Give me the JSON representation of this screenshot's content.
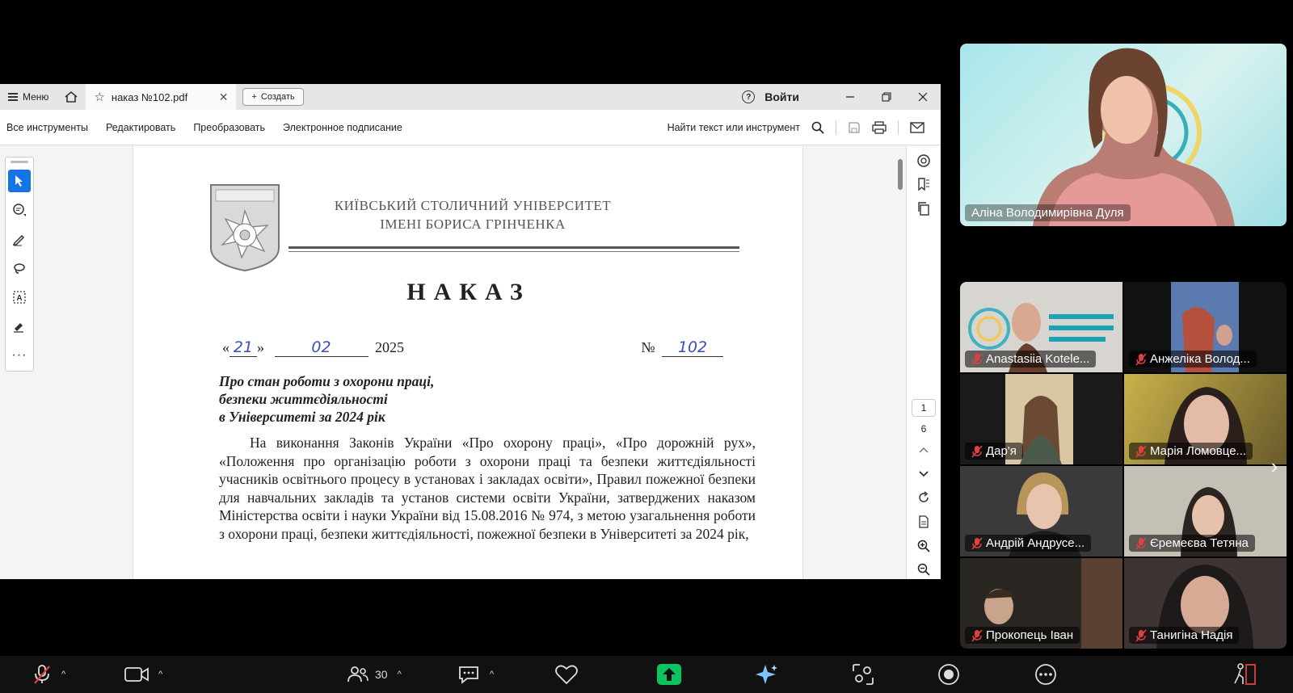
{
  "acrobat": {
    "menu_label": "Меню",
    "tab_title": "наказ №102.pdf",
    "create_label": "Создать",
    "signin_label": "Войти",
    "toolbar": {
      "all_tools": "Все инструменты",
      "edit": "Редактировать",
      "convert": "Преобразовать",
      "esign": "Электронное подписание",
      "search_label": "Найти текст или инструмент"
    },
    "page_current": "1",
    "page_total": "6"
  },
  "document": {
    "university_line1": "КИЇВСЬКИЙ СТОЛИЧНИЙ УНІВЕРСИТЕТ",
    "university_line2": "ІМЕНІ БОРИСА ГРІНЧЕНКА",
    "heading": "НАКАЗ",
    "date_open_quote": "«",
    "date_day": "21",
    "date_close_quote": "»",
    "date_month": "02",
    "date_year": "2025",
    "number_label": "№",
    "number_value": "102",
    "subject_line1": "Про стан роботи з охорони праці,",
    "subject_line2": "безпеки життєдіяльності",
    "subject_line3": "в Університеті за 2024 рік",
    "body": "На виконання Законів України «Про охорону праці», «Про дорожній рух», «Положення про організацію роботи з охорони праці та безпеки життєдіяльності учасників освітнього процесу в установах і закладах освіти», Правил пожежної безпеки для навчальних закладів та установ системи освіти України, затверджених наказом Міністерства освіти і науки України від 15.08.2016 № 974, з метою узагальнення роботи з охорони праці, безпеки життєдіяльності, пожежної безпеки в Університеті за 2024 рік,"
  },
  "presenter": {
    "name": "Аліна Володимирівна Дуля"
  },
  "participants": [
    {
      "name": "Anastasiia Kotele...",
      "bg": "#d8d4cf"
    },
    {
      "name": "Анжеліка Волод...",
      "bg": "#3a4a66"
    },
    {
      "name": "Дар'я",
      "bg": "#2b2a24"
    },
    {
      "name": "Марія Ломовце...",
      "bg": "#7a6a3a"
    },
    {
      "name": "Андрій Андрусе...",
      "bg": "#3b3a3a"
    },
    {
      "name": "Єремеєва Тетяна",
      "bg": "#b9b3a8"
    },
    {
      "name": "Прокопець Іван",
      "bg": "#2a2622"
    },
    {
      "name": "Танигіна Надія",
      "bg": "#3e3433"
    }
  ],
  "meeting_bar": {
    "participants_count": "30"
  },
  "colors": {
    "accent_blue": "#1473e6",
    "muted_red": "#e04040",
    "share_green": "#0cc45f",
    "handwriting_blue": "#3b4fb8"
  }
}
